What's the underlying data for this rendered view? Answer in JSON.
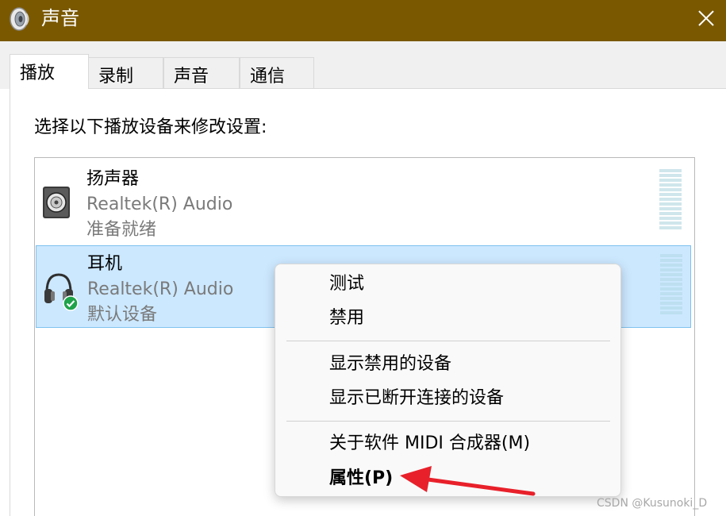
{
  "window": {
    "title": "声音",
    "title_icon": "speaker-icon",
    "close_icon": "close-icon"
  },
  "tabs": [
    {
      "label": "播放",
      "active": true
    },
    {
      "label": "录制",
      "active": false
    },
    {
      "label": "声音",
      "active": false
    },
    {
      "label": "通信",
      "active": false
    }
  ],
  "instruction": "选择以下播放设备来修改设置:",
  "devices": [
    {
      "name": "扬声器",
      "driver": "Realtek(R) Audio",
      "status": "准备就绪",
      "icon": "speaker-icon",
      "selected": false
    },
    {
      "name": "耳机",
      "driver": "Realtek(R) Audio",
      "status": "默认设备",
      "icon": "headphones-icon",
      "selected": true,
      "badge_icon": "default-check-icon"
    }
  ],
  "context_menu": {
    "items": [
      {
        "label": "测试"
      },
      {
        "label": "禁用"
      },
      {
        "label": "显示禁用的设备"
      },
      {
        "label": "显示已断开连接的设备"
      },
      {
        "label": "关于软件 MIDI 合成器(M)"
      },
      {
        "label": "属性(P)",
        "bold": true
      }
    ]
  },
  "annotation": {
    "icon": "red-arrow-icon",
    "color": "#e8202a"
  },
  "watermark": "CSDN @Kusunoki_D",
  "colors": {
    "titlebar": "#7a5800",
    "selection": "#cce8ff",
    "selection_border": "#7fc1ee",
    "default_badge": "#1ea34a"
  }
}
